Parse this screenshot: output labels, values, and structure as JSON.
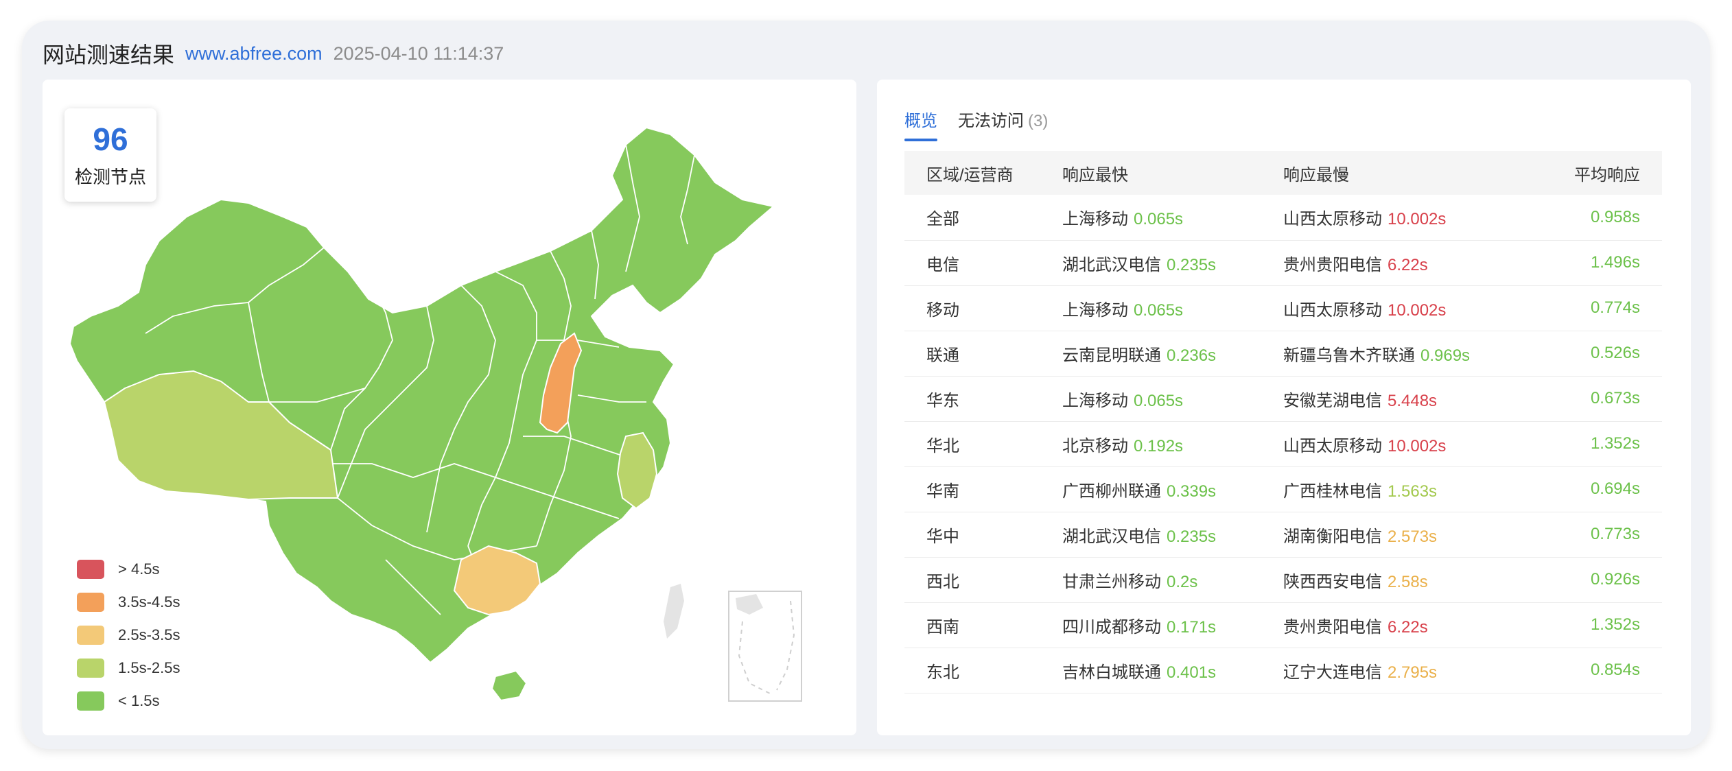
{
  "header": {
    "title": "网站测速结果",
    "url": "www.abfree.com",
    "timestamp": "2025-04-10 11:14:37"
  },
  "map": {
    "node_count": "96",
    "node_label": "检测节点",
    "legend": [
      {
        "label": "> 4.5s",
        "color": "#d8545c"
      },
      {
        "label": "3.5s-4.5s",
        "color": "#f3a05a"
      },
      {
        "label": "2.5s-3.5s",
        "color": "#f3c978"
      },
      {
        "label": "1.5s-2.5s",
        "color": "#b9d46a"
      },
      {
        "label": "< 1.5s",
        "color": "#86c95c"
      }
    ]
  },
  "tabs": [
    {
      "label": "概览",
      "count": "",
      "active": true
    },
    {
      "label": "无法访问",
      "count": "(3)",
      "active": false
    }
  ],
  "table": {
    "headers": [
      "区域/运营商",
      "响应最快",
      "响应最慢",
      "平均响应"
    ],
    "rows": [
      {
        "region": "全部",
        "fast_name": "上海移动",
        "fast_val": "0.065s",
        "slow_name": "山西太原移动",
        "slow_val": "10.002s",
        "slow_cls": "r",
        "avg": "0.958s"
      },
      {
        "region": "电信",
        "fast_name": "湖北武汉电信",
        "fast_val": "0.235s",
        "slow_name": "贵州贵阳电信",
        "slow_val": "6.22s",
        "slow_cls": "r",
        "avg": "1.496s"
      },
      {
        "region": "移动",
        "fast_name": "上海移动",
        "fast_val": "0.065s",
        "slow_name": "山西太原移动",
        "slow_val": "10.002s",
        "slow_cls": "r",
        "avg": "0.774s"
      },
      {
        "region": "联通",
        "fast_name": "云南昆明联通",
        "fast_val": "0.236s",
        "slow_name": "新疆乌鲁木齐联通",
        "slow_val": "0.969s",
        "slow_cls": "g",
        "avg": "0.526s"
      },
      {
        "region": "华东",
        "fast_name": "上海移动",
        "fast_val": "0.065s",
        "slow_name": "安徽芜湖电信",
        "slow_val": "5.448s",
        "slow_cls": "r",
        "avg": "0.673s"
      },
      {
        "region": "华北",
        "fast_name": "北京移动",
        "fast_val": "0.192s",
        "slow_name": "山西太原移动",
        "slow_val": "10.002s",
        "slow_cls": "r",
        "avg": "1.352s"
      },
      {
        "region": "华南",
        "fast_name": "广西柳州联通",
        "fast_val": "0.339s",
        "slow_name": "广西桂林电信",
        "slow_val": "1.563s",
        "slow_cls": "yg",
        "avg": "0.694s"
      },
      {
        "region": "华中",
        "fast_name": "湖北武汉电信",
        "fast_val": "0.235s",
        "slow_name": "湖南衡阳电信",
        "slow_val": "2.573s",
        "slow_cls": "o",
        "avg": "0.773s"
      },
      {
        "region": "西北",
        "fast_name": "甘肃兰州移动",
        "fast_val": "0.2s",
        "slow_name": "陕西西安电信",
        "slow_val": "2.58s",
        "slow_cls": "o",
        "avg": "0.926s"
      },
      {
        "region": "西南",
        "fast_name": "四川成都移动",
        "fast_val": "0.171s",
        "slow_name": "贵州贵阳电信",
        "slow_val": "6.22s",
        "slow_cls": "r",
        "avg": "1.352s"
      },
      {
        "region": "东北",
        "fast_name": "吉林白城联通",
        "fast_val": "0.401s",
        "slow_name": "辽宁大连电信",
        "slow_val": "2.795s",
        "slow_cls": "o",
        "avg": "0.854s"
      }
    ]
  }
}
